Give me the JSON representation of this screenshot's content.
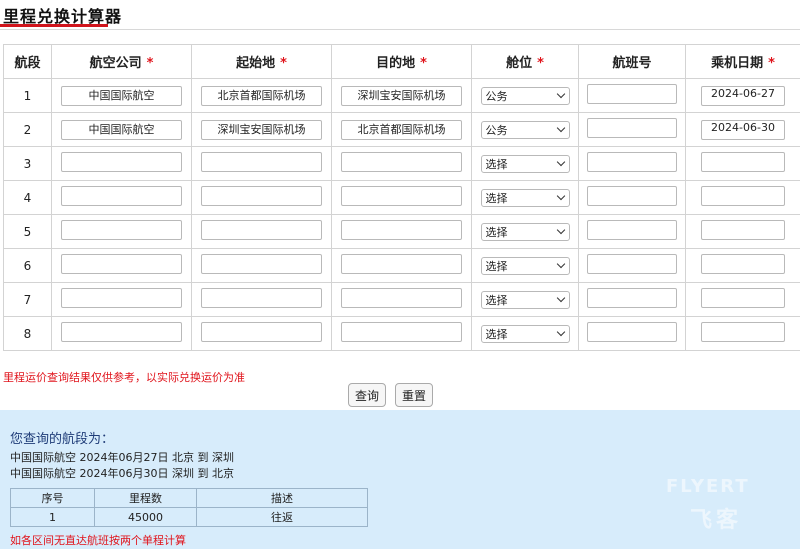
{
  "page": {
    "title": "里程兑换计算器"
  },
  "table": {
    "headers": {
      "leg": "航段",
      "airline": "航空公司",
      "origin": "起始地",
      "destination": "目的地",
      "cabin": "舱位",
      "flight_no": "航班号",
      "date": "乘机日期"
    },
    "required_mark": "*",
    "rows": [
      {
        "num": "1",
        "airline": "中国国际航空",
        "origin": "北京首都国际机场",
        "destination": "深圳宝安国际机场",
        "cabin": "公务",
        "flight_no": "",
        "date": "2024-06-27"
      },
      {
        "num": "2",
        "airline": "中国国际航空",
        "origin": "深圳宝安国际机场",
        "destination": "北京首都国际机场",
        "cabin": "公务",
        "flight_no": "",
        "date": "2024-06-30"
      },
      {
        "num": "3",
        "airline": "",
        "origin": "",
        "destination": "",
        "cabin": "选择",
        "flight_no": "",
        "date": ""
      },
      {
        "num": "4",
        "airline": "",
        "origin": "",
        "destination": "",
        "cabin": "选择",
        "flight_no": "",
        "date": ""
      },
      {
        "num": "5",
        "airline": "",
        "origin": "",
        "destination": "",
        "cabin": "选择",
        "flight_no": "",
        "date": ""
      },
      {
        "num": "6",
        "airline": "",
        "origin": "",
        "destination": "",
        "cabin": "选择",
        "flight_no": "",
        "date": ""
      },
      {
        "num": "7",
        "airline": "",
        "origin": "",
        "destination": "",
        "cabin": "选择",
        "flight_no": "",
        "date": ""
      },
      {
        "num": "8",
        "airline": "",
        "origin": "",
        "destination": "",
        "cabin": "选择",
        "flight_no": "",
        "date": ""
      }
    ]
  },
  "disclaimer": "里程运价查询结果仅供参考，以实际兑换运价为准",
  "buttons": {
    "query": "查询",
    "reset": "重置"
  },
  "result": {
    "heading": "您查询的航段为：",
    "lines": [
      "中国国际航空  2024年06月27日  北京 到 深圳",
      "中国国际航空  2024年06月30日  深圳 到 北京"
    ],
    "table_headers": {
      "index": "序号",
      "miles": "里程数",
      "description": "描述"
    },
    "rows": [
      {
        "index": "1",
        "miles": "45000",
        "description": "往返"
      }
    ],
    "footnote": "如各区间无直达航班按两个单程计算"
  },
  "watermark": {
    "top": "FLYERT",
    "bottom": "飞客"
  },
  "colors": {
    "accent_red": "#d0141c",
    "result_bg": "#d7ecfb",
    "result_heading": "#1f3c78"
  }
}
